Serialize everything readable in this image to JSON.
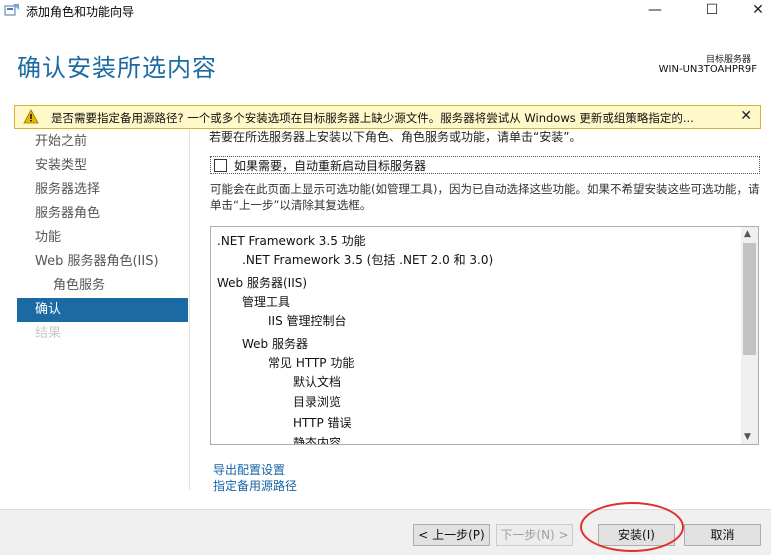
{
  "window": {
    "title": "添加角色和功能向导",
    "min_glyph": "—",
    "max_glyph": "☐",
    "close_glyph": "✕"
  },
  "header": {
    "page_title": "确认安装所选内容",
    "server_label": "目标服务器",
    "server_name": "WIN-UN3TOAHPR9F"
  },
  "warning": {
    "text": "是否需要指定备用源路径? 一个或多个安装选项在目标服务器上缺少源文件。服务器将尝试从 Windows 更新或组策略指定的...",
    "close_glyph": "✕",
    "accent": "#d8b52a",
    "background": "#fff8c8"
  },
  "nav": {
    "items": [
      {
        "label": "开始之前"
      },
      {
        "label": "安装类型"
      },
      {
        "label": "服务器选择"
      },
      {
        "label": "服务器角色"
      },
      {
        "label": "功能"
      },
      {
        "label": "Web 服务器角色(IIS)"
      },
      {
        "label": "角色服务"
      },
      {
        "label": "确认"
      },
      {
        "label": "结果"
      }
    ],
    "active_color": "#1b6aa3"
  },
  "main": {
    "intro": "若要在所选服务器上安装以下角色、角色服务或功能，请单击“安装”。",
    "restart_label": "如果需要，自动重新启动目标服务器",
    "note": "可能会在此页面上显示可选功能(如管理工具)，因为已自动选择这些功能。如果不希望安装这些可选功能，请单击“上一步”以清除其复选框。",
    "features": [
      ".NET Framework 3.5 功能",
      ".NET Framework 3.5 (包括 .NET 2.0 和 3.0)",
      "Web 服务器(IIS)",
      "管理工具",
      "IIS 管理控制台",
      "Web 服务器",
      "常见 HTTP 功能",
      "默认文档",
      "目录浏览",
      "HTTP 错误",
      "静态内容"
    ],
    "links": {
      "export": "导出配置设置",
      "alt_source": "指定备用源路径"
    }
  },
  "footer": {
    "prev": "< 上一步(P)",
    "next": "下一步(N) >",
    "install": "安装(I)",
    "cancel": "取消"
  },
  "colors": {
    "title_blue": "#1b6aa3",
    "link_blue": "#1563a5",
    "highlight_red": "#e0302c"
  }
}
